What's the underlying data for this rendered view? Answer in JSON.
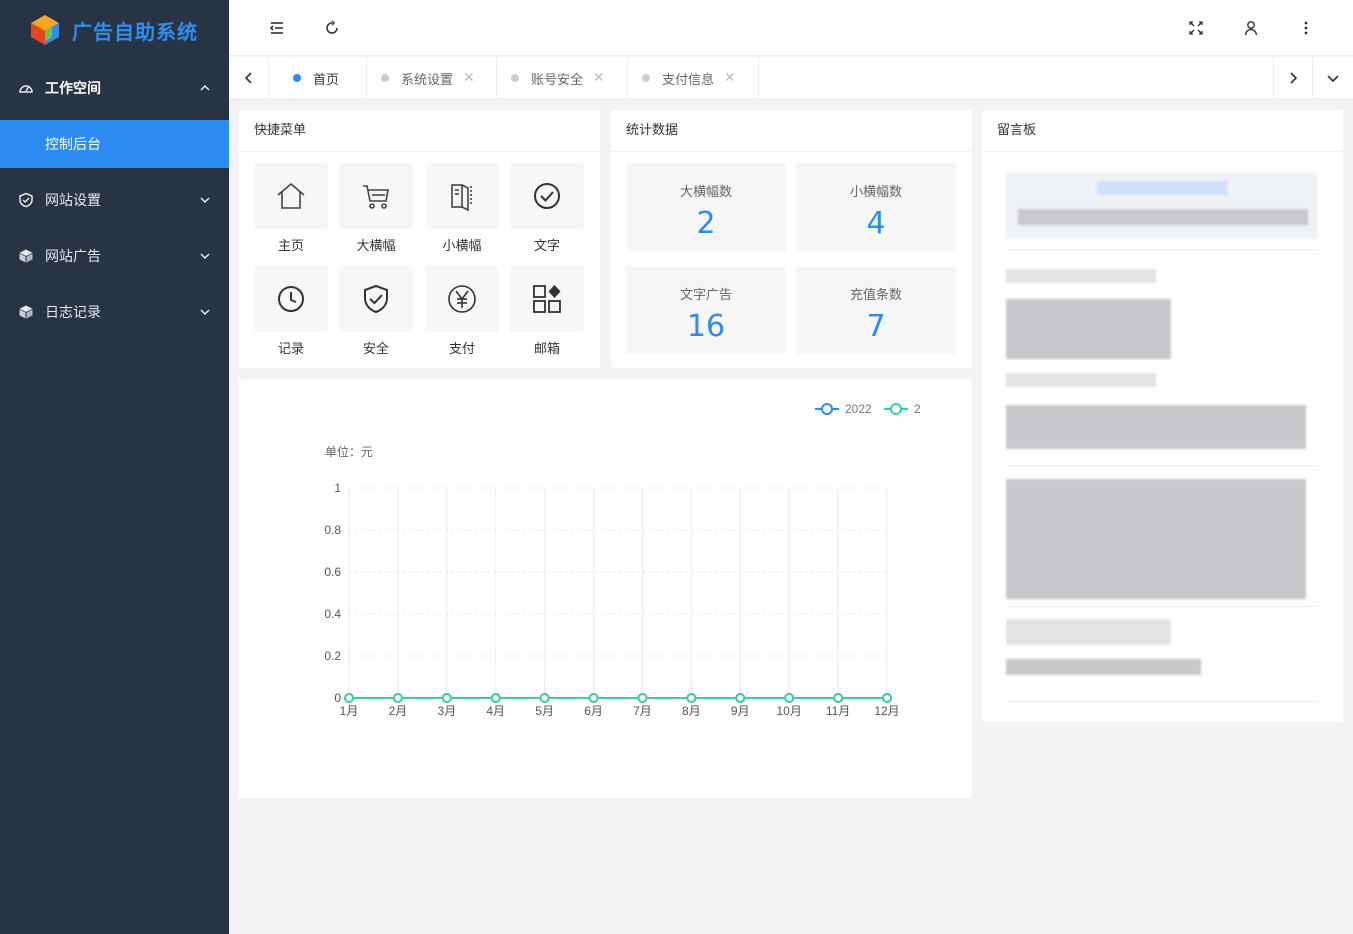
{
  "app": {
    "title": "广告自助系统"
  },
  "sidebar": {
    "items": [
      {
        "label": "工作空间",
        "icon": "dashboard-icon",
        "open": true,
        "children": [
          {
            "label": "控制后台"
          }
        ]
      },
      {
        "label": "网站设置",
        "icon": "shield-icon"
      },
      {
        "label": "网站广告",
        "icon": "cube-icon"
      },
      {
        "label": "日志记录",
        "icon": "cube-icon"
      }
    ]
  },
  "tabs": [
    {
      "label": "首页",
      "active": true
    },
    {
      "label": "系统设置"
    },
    {
      "label": "账号安全"
    },
    {
      "label": "支付信息"
    }
  ],
  "quick_menu": {
    "title": "快捷菜单",
    "items": [
      {
        "label": "主页",
        "icon": "home-icon"
      },
      {
        "label": "大横幅",
        "icon": "cart-icon"
      },
      {
        "label": "小横幅",
        "icon": "book-icon"
      },
      {
        "label": "文字",
        "icon": "check-circle-icon"
      },
      {
        "label": "记录",
        "icon": "clock-icon"
      },
      {
        "label": "安全",
        "icon": "shield-check-icon"
      },
      {
        "label": "支付",
        "icon": "yen-icon"
      },
      {
        "label": "邮箱",
        "icon": "apps-icon"
      }
    ]
  },
  "stats": {
    "title": "统计数据",
    "items": [
      {
        "label": "大横幅数",
        "value": "2"
      },
      {
        "label": "小横幅数",
        "value": "4"
      },
      {
        "label": "文字广告",
        "value": "16"
      },
      {
        "label": "充值条数",
        "value": "7"
      }
    ]
  },
  "board": {
    "title": "留言板"
  },
  "chart_data": {
    "type": "line",
    "unit_label": "单位：元",
    "categories": [
      "1月",
      "2月",
      "3月",
      "4月",
      "5月",
      "6月",
      "7月",
      "8月",
      "9月",
      "10月",
      "11月",
      "12月"
    ],
    "series": [
      {
        "name": "2022",
        "color": "#2d8cf0",
        "values": [
          0,
          0,
          0,
          0,
          0,
          0,
          0,
          0,
          0,
          0,
          0,
          0
        ]
      },
      {
        "name": "2",
        "color": "#3ecf9e",
        "values": [
          0,
          0,
          0,
          0,
          0,
          0,
          0,
          0,
          0,
          0,
          0,
          0
        ]
      }
    ],
    "yticks": [
      "0",
      "0.2",
      "0.4",
      "0.6",
      "0.8",
      "1"
    ],
    "ylim": [
      0,
      1
    ],
    "legend": "top-right"
  }
}
